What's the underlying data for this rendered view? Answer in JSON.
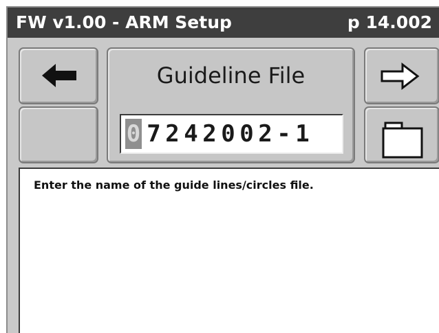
{
  "titlebar": {
    "title": "FW v1.00 - ARM Setup",
    "page": "p 14.002"
  },
  "nav": {
    "back_icon": "arrow-left-icon",
    "next_icon": "arrow-right-icon",
    "file_icon": "folder-icon"
  },
  "field": {
    "label": "Guideline File",
    "cursor_char": "0",
    "value_rest": "7242002-1"
  },
  "description": {
    "text": "Enter the name of the guide lines/circles file."
  }
}
